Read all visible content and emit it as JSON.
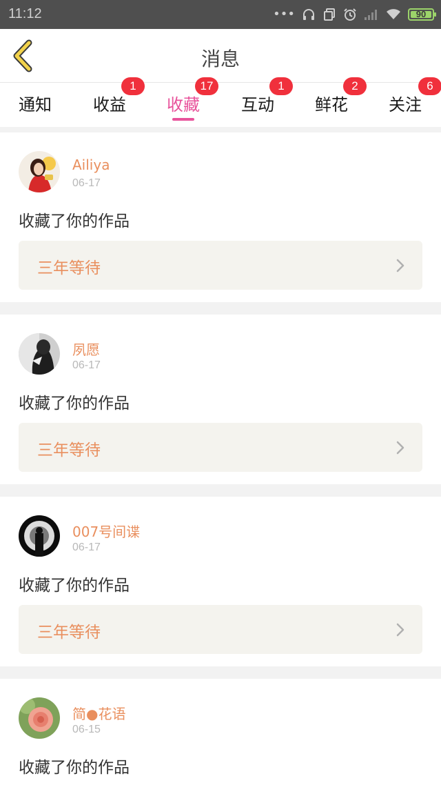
{
  "status_bar": {
    "time": "11:12",
    "battery_level": "90",
    "icons": [
      "more-dots-icon",
      "headset-icon",
      "copy-icon",
      "alarm-icon",
      "signal-icon",
      "wifi-icon",
      "battery-icon"
    ]
  },
  "header": {
    "title": "消息",
    "back_icon": "chevron-left-icon"
  },
  "tabs": [
    {
      "label": "通知",
      "badge": ""
    },
    {
      "label": "收益",
      "badge": "1"
    },
    {
      "label": "收藏",
      "badge": "17",
      "active": true
    },
    {
      "label": "互动",
      "badge": "1"
    },
    {
      "label": "鲜花",
      "badge": "2"
    },
    {
      "label": "关注",
      "badge": "6"
    }
  ],
  "messages": [
    {
      "user": "Ailiya",
      "date": "06-17",
      "action": "收藏了你的作品",
      "work_title": "三年等待"
    },
    {
      "user": "夙愿",
      "date": "06-17",
      "action": "收藏了你的作品",
      "work_title": "三年等待"
    },
    {
      "user": "007号间谍",
      "date": "06-17",
      "action": "收藏了你的作品",
      "work_title": "三年等待"
    },
    {
      "user": "简●花语",
      "date": "06-15",
      "action": "收藏了你的作品",
      "work_title": ""
    }
  ],
  "colors": {
    "accent_pink": "#e8539b",
    "name_orange": "#e98f5e",
    "badge_red": "#f0303c",
    "back_arrow_yellow": "#f2d24b"
  }
}
